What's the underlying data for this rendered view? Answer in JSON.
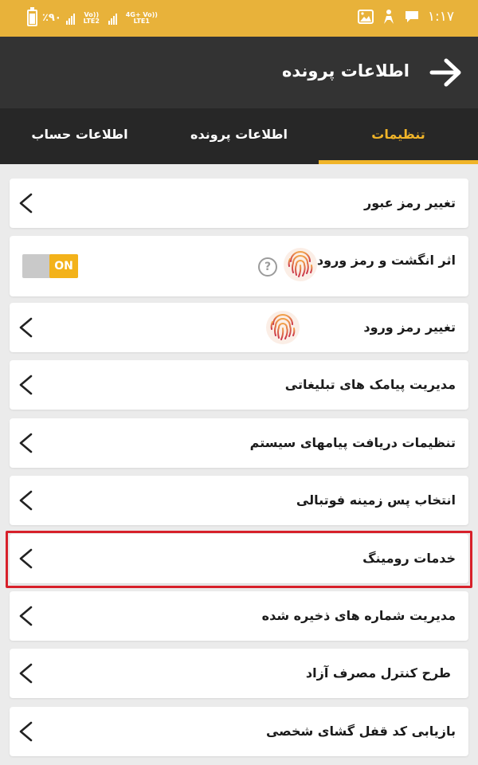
{
  "status_bar": {
    "battery": "٪۹۰",
    "sim2": "Vo)) LTE2",
    "sim1": "4G+ Vo)) LTE1",
    "time": "۱:۱۷"
  },
  "header": {
    "title": "اطلاعات پرونده"
  },
  "tabs": [
    {
      "label": "تنظیمات",
      "active": true
    },
    {
      "label": "اطلاعات پرونده",
      "active": false
    },
    {
      "label": "اطلاعات حساب",
      "active": false
    }
  ],
  "settings": {
    "items": [
      {
        "label": "تغییر رمز عبور"
      },
      {
        "label": "اثر انگشت و رمز ورود",
        "toggle": "ON"
      },
      {
        "label": "تغییر رمز ورود"
      },
      {
        "label": "مدیریت پیامک های تبلیغاتی"
      },
      {
        "label": "تنظیمات دریافت پیامهای سیستم"
      },
      {
        "label": "انتخاب پس زمینه فوتبالی"
      },
      {
        "label": "خدمات رومینگ",
        "highlighted": true
      },
      {
        "label": "مدیریت شماره های ذخیره شده"
      },
      {
        "label": "طرح کنترل مصرف آزاد"
      },
      {
        "label": "بازیابی کد قفل گشای شخصی"
      }
    ]
  },
  "colors": {
    "status_bar": "#e8b23a",
    "header": "#333333",
    "tabs": "#272727",
    "accent": "#f0b429",
    "highlight": "#d7202a"
  }
}
